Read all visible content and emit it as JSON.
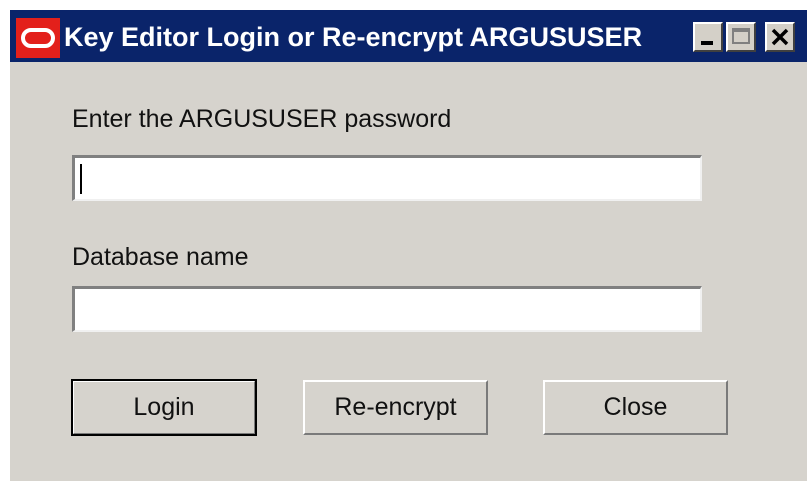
{
  "window": {
    "title": "Key Editor Login or Re-encrypt ARGUSUSER",
    "icon": "oracle-logo-icon",
    "controls": [
      "minimize-icon",
      "maximize-icon",
      "close-icon"
    ]
  },
  "form": {
    "password_label": "Enter the ARGUSUSER password",
    "password_value": "",
    "database_label": "Database name",
    "database_value": ""
  },
  "buttons": {
    "login": "Login",
    "reencrypt": "Re-encrypt",
    "close": "Close"
  },
  "colors": {
    "titlebar": "#0a246a",
    "dialog_bg": "#d6d3cd",
    "oracle_red": "#e3201b"
  }
}
